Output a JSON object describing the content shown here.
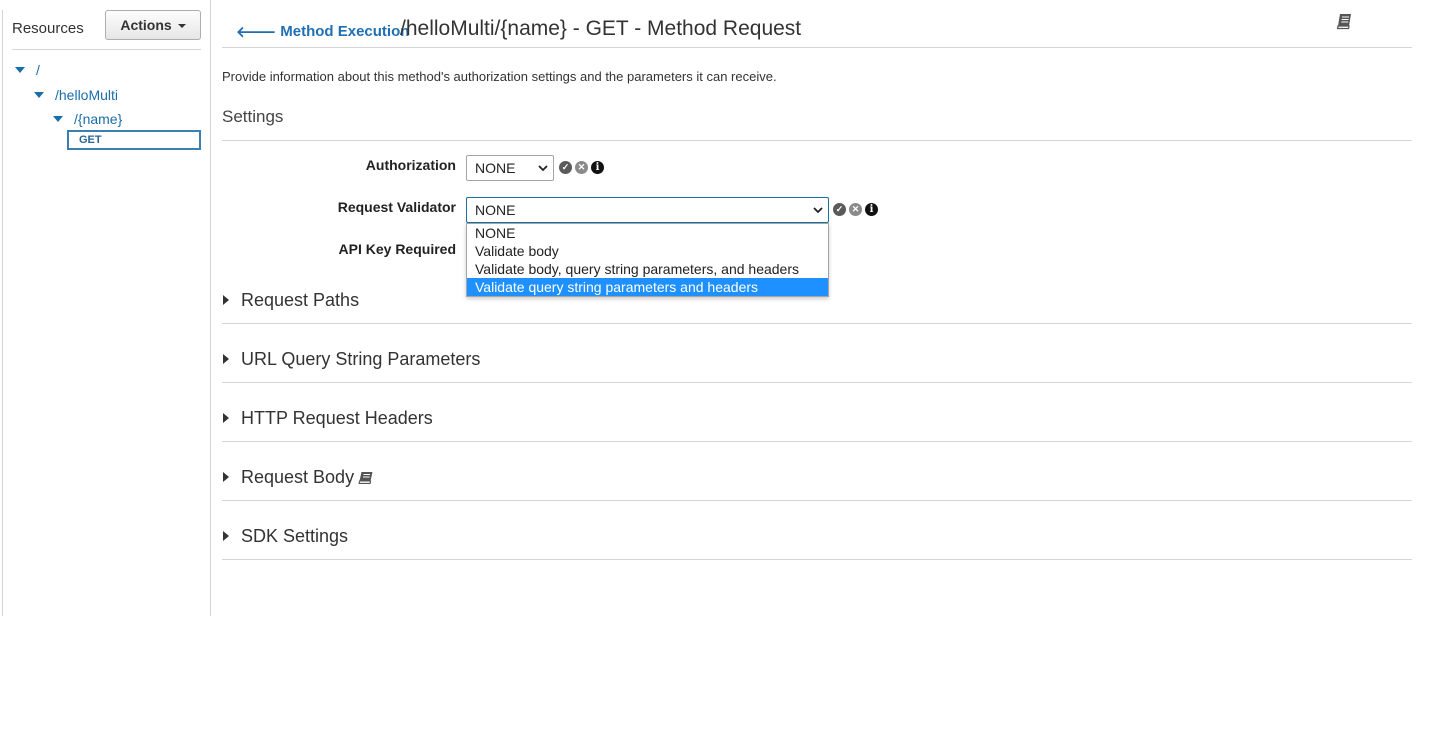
{
  "sidebar": {
    "title": "Resources",
    "actions_label": "Actions",
    "tree": [
      {
        "label": "/"
      },
      {
        "label": "/helloMulti"
      },
      {
        "label": "/{name}"
      }
    ],
    "method": "GET"
  },
  "header": {
    "back_label": "Method Execution",
    "title": "/helloMulti/{name} - GET - Method Request"
  },
  "description": "Provide information about this method's authorization settings and the parameters it can receive.",
  "settings": {
    "title": "Settings",
    "authorization": {
      "label": "Authorization",
      "value": "NONE"
    },
    "request_validator": {
      "label": "Request Validator",
      "value": "NONE",
      "options": [
        "NONE",
        "Validate body",
        "Validate body, query string parameters, and headers",
        "Validate query string parameters and headers"
      ],
      "highlighted_index": 3
    },
    "api_key": {
      "label": "API Key Required"
    }
  },
  "sections": [
    {
      "label": "Request Paths"
    },
    {
      "label": "URL Query String Parameters"
    },
    {
      "label": "HTTP Request Headers"
    },
    {
      "label": "Request Body"
    },
    {
      "label": "SDK Settings"
    }
  ],
  "colors": {
    "link": "#1f6fb2",
    "highlight": "#1e90ff",
    "divider": "#d5d5d5"
  },
  "icons": [
    "arrow-left-icon",
    "book-icon",
    "check-circle-icon",
    "cancel-circle-icon",
    "info-circle-icon",
    "caret-down-icon",
    "triangle-right-icon"
  ]
}
